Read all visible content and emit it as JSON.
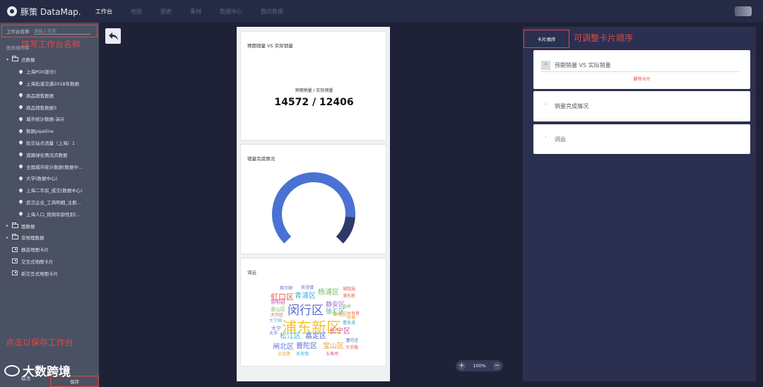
{
  "app": {
    "logo_text": "豚策 DataMap."
  },
  "nav": [
    {
      "label": "工作台",
      "active": true
    },
    {
      "label": "地图",
      "active": false
    },
    {
      "label": "图表",
      "active": false
    },
    {
      "label": "素材",
      "active": false
    },
    {
      "label": "数据中心",
      "active": false
    },
    {
      "label": "我的数据",
      "active": false
    }
  ],
  "sidebar": {
    "name_label": "工作台名称",
    "name_placeholder": "请输入名称",
    "annotation_name": "填写工作台名称",
    "section_label": "图表组件库",
    "tree": [
      {
        "kind": "folder",
        "label": "点数据",
        "expanded": true
      },
      {
        "kind": "leaf",
        "label": "上海POI(部分)"
      },
      {
        "kind": "leaf",
        "label": "上海轨道交通2018年数据"
      },
      {
        "kind": "leaf",
        "label": "商品销售数据"
      },
      {
        "kind": "leaf",
        "label": "商品销售数据3"
      },
      {
        "kind": "leaf",
        "label": "城市统计数据-演示"
      },
      {
        "kind": "leaf",
        "label": "数据pipeline"
      },
      {
        "kind": "leaf",
        "label": "轨交站点流量（上海）1"
      },
      {
        "kind": "leaf",
        "label": "道路绿化情况点数据"
      },
      {
        "kind": "leaf",
        "label": "全国城市统计数据(数据中..."
      },
      {
        "kind": "leaf",
        "label": "大学(数据中心)"
      },
      {
        "kind": "leaf",
        "label": "上海二手房_成交(数据中心)"
      },
      {
        "kind": "leaf",
        "label": "武汉企业_工商明细_注册..."
      },
      {
        "kind": "leaf",
        "label": "上海人口_按周年龄性别(..."
      },
      {
        "kind": "folder",
        "label": "面数据",
        "expanded": false
      },
      {
        "kind": "folder",
        "label": "非地理数据",
        "expanded": false
      },
      {
        "kind": "card",
        "label": "静态地图卡片"
      },
      {
        "kind": "card",
        "label": "交互式地图卡片"
      },
      {
        "kind": "card",
        "label": "新交互式地图卡片"
      }
    ],
    "cancel_label": "取消",
    "save_label": "保存",
    "annotation_save": "点击以保存工作台",
    "watermark": "大数跨境"
  },
  "canvas": {
    "card1": {
      "title": "预期销量 VS 实际销量",
      "kpi_label": "预期销量 / 实际销量",
      "kpi_value": "14572 / 12406"
    },
    "card2": {
      "title": "销量完成情况",
      "gauge": {
        "value_fraction": 0.85,
        "color_main": "#4a72d4",
        "color_rest": "#2f3a66"
      }
    },
    "card3": {
      "title": "词云",
      "words": [
        {
          "text": "浦东新区",
          "color": "#f2c230"
        },
        {
          "text": "闵行区",
          "color": "#5a6cc9"
        },
        {
          "text": "虹口区",
          "color": "#e85a4a"
        },
        {
          "text": "青浦区",
          "color": "#3fb3d6"
        },
        {
          "text": "杨浦区",
          "color": "#6cbf5a"
        },
        {
          "text": "静安区",
          "color": "#9a6bd1"
        },
        {
          "text": "徐汇区",
          "color": "#4ab089"
        },
        {
          "text": "松江区",
          "color": "#3fb3d6"
        },
        {
          "text": "嘉定区",
          "color": "#5a6cc9"
        },
        {
          "text": "长宁区",
          "color": "#d84fa6"
        },
        {
          "text": "闸北区",
          "color": "#6a7adb"
        },
        {
          "text": "普陀区",
          "color": "#5a6cc9"
        },
        {
          "text": "宝山区",
          "color": "#e0a030"
        },
        {
          "text": "金山区",
          "color": "#6cbf5a"
        },
        {
          "text": "奉贤区",
          "color": "#e0a030"
        },
        {
          "text": "崇明县",
          "color": "#d84fa6"
        },
        {
          "text": "大宁",
          "color": "#5a6cc9"
        },
        {
          "text": "吴泾镇",
          "color": "#5a6cc9"
        },
        {
          "text": "希尔顿",
          "color": "#5a6cc9"
        },
        {
          "text": "城隍庙",
          "color": "#e85a4a"
        },
        {
          "text": "浦东新",
          "color": "#e85a4a"
        },
        {
          "text": "大宁国",
          "color": "#3fb3d6"
        },
        {
          "text": "大华",
          "color": "#5a6cc9"
        },
        {
          "text": "文化体",
          "color": "#e0a030"
        },
        {
          "text": "吴淞镇",
          "color": "#3fb3d6"
        },
        {
          "text": "五角场",
          "color": "#d84fa6"
        },
        {
          "text": "曹家渡",
          "color": "#3fb3d6"
        },
        {
          "text": "大华区",
          "color": "#e85a4a"
        },
        {
          "text": "金桥",
          "color": "#6cbf5a"
        },
        {
          "text": "大世界",
          "color": "#e85a4a"
        },
        {
          "text": "漕河泾",
          "color": "#5a6cc9"
        },
        {
          "text": "大宇路",
          "color": "#e85a4a"
        },
        {
          "text": "世博",
          "color": "#e0a030"
        }
      ]
    }
  },
  "zoom": {
    "minus": "−",
    "plus": "+",
    "value": "100%"
  },
  "right_panel": {
    "tab_label": "卡片顺序",
    "annotation_order": "可调整卡片顺序",
    "items": [
      {
        "title": "预期销量 VS 实际销量",
        "expanded": true,
        "delete_label": "删除卡片"
      },
      {
        "title": "销量完成情况",
        "expanded": false
      },
      {
        "title": "词云",
        "expanded": false
      }
    ]
  }
}
